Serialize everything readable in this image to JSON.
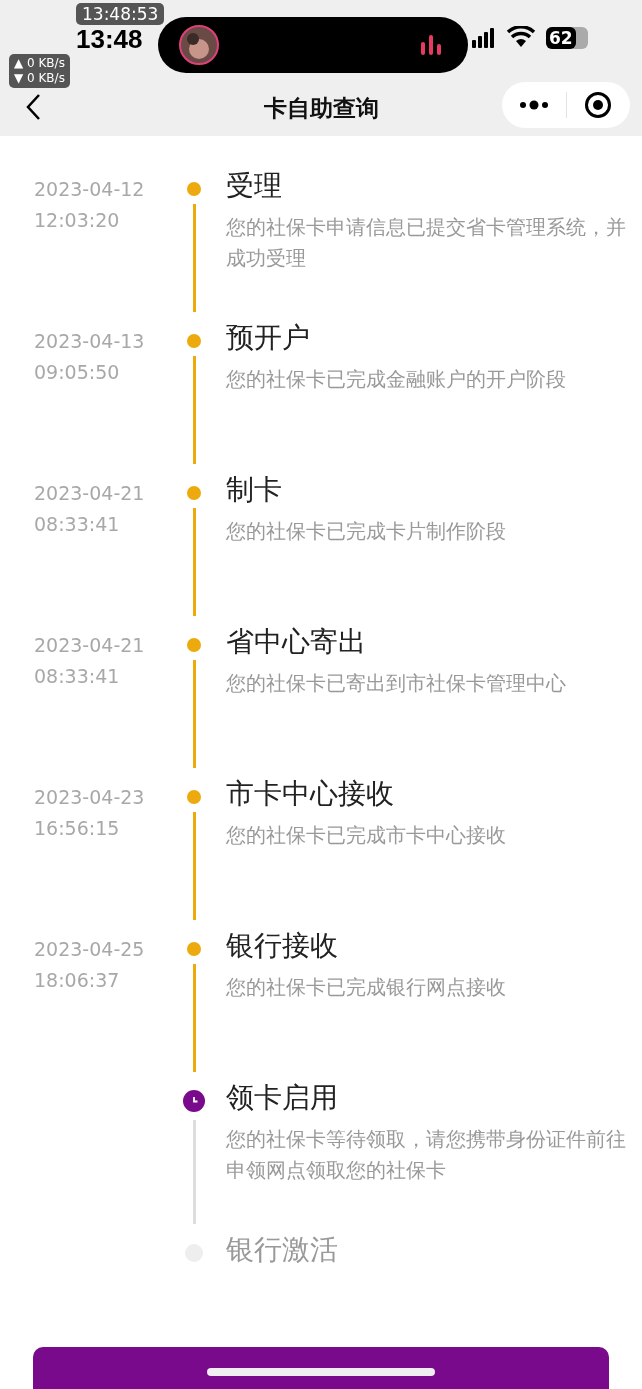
{
  "status_bar": {
    "clock_badge": "13:48:53",
    "time": "13:48",
    "upload_speed": "▲ 0 KB/s",
    "download_speed": "▼ 0 KB/s",
    "battery": "62"
  },
  "nav": {
    "title": "卡自助查询"
  },
  "steps": [
    {
      "date": "2023-04-12",
      "clock": "12:03:20",
      "title": "受理",
      "desc": "您的社保卡申请信息已提交省卡管理系统，并成功受理",
      "done": true,
      "current": false
    },
    {
      "date": "2023-04-13",
      "clock": "09:05:50",
      "title": "预开户",
      "desc": "您的社保卡已完成金融账户的开户阶段",
      "done": true,
      "current": false
    },
    {
      "date": "2023-04-21",
      "clock": "08:33:41",
      "title": "制卡",
      "desc": "您的社保卡已完成卡片制作阶段",
      "done": true,
      "current": false
    },
    {
      "date": "2023-04-21",
      "clock": "08:33:41",
      "title": "省中心寄出",
      "desc": "您的社保卡已寄出到市社保卡管理中心",
      "done": true,
      "current": false
    },
    {
      "date": "2023-04-23",
      "clock": "16:56:15",
      "title": "市卡中心接收",
      "desc": "您的社保卡已完成市卡中心接收",
      "done": true,
      "current": false
    },
    {
      "date": "2023-04-25",
      "clock": "18:06:37",
      "title": "银行接收",
      "desc": "您的社保卡已完成银行网点接收",
      "done": true,
      "current": false
    },
    {
      "title": "领卡启用",
      "desc": "您的社保卡等待领取，请您携带身份证件前往申领网点领取您的社保卡",
      "done": false,
      "current": true
    },
    {
      "title": "银行激活",
      "done": false,
      "current": false
    }
  ]
}
